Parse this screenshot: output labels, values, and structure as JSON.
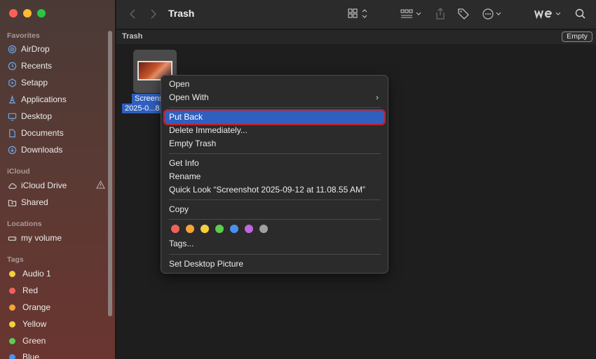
{
  "window": {
    "title": "Trash"
  },
  "sidebar": {
    "favorites_title": "Favorites",
    "favorites": [
      {
        "label": "AirDrop",
        "icon": "airdrop-icon"
      },
      {
        "label": "Recents",
        "icon": "clock-icon"
      },
      {
        "label": "Setapp",
        "icon": "setapp-icon"
      },
      {
        "label": "Applications",
        "icon": "applications-icon"
      },
      {
        "label": "Desktop",
        "icon": "desktop-icon"
      },
      {
        "label": "Documents",
        "icon": "document-icon"
      },
      {
        "label": "Downloads",
        "icon": "download-icon"
      }
    ],
    "icloud_title": "iCloud",
    "icloud": [
      {
        "label": "iCloud Drive",
        "icon": "cloud-icon",
        "status_icon": "warning-icon"
      },
      {
        "label": "Shared",
        "icon": "shared-folder-icon"
      }
    ],
    "locations_title": "Locations",
    "locations": [
      {
        "label": "my volume",
        "icon": "drive-icon"
      }
    ],
    "tags_title": "Tags",
    "tags": [
      {
        "label": "Audio 1",
        "color": "#f4d03f"
      },
      {
        "label": "Red",
        "color": "#f0625a"
      },
      {
        "label": "Orange",
        "color": "#f5a536"
      },
      {
        "label": "Yellow",
        "color": "#f4d03f"
      },
      {
        "label": "Green",
        "color": "#5ccd4e"
      },
      {
        "label": "Blue",
        "color": "#4a90ee"
      }
    ]
  },
  "pathbar": {
    "label": "Trash",
    "empty_button": "Empty"
  },
  "file": {
    "name_line1": "Screens",
    "name_line2": "2025-0...8"
  },
  "context_menu": {
    "items": [
      {
        "label": "Open"
      },
      {
        "label": "Open With",
        "has_submenu": true
      },
      {
        "label": "Put Back",
        "selected": true
      },
      {
        "label": "Delete Immediately..."
      },
      {
        "label": "Empty Trash"
      },
      {
        "label": "Get Info"
      },
      {
        "label": "Rename"
      },
      {
        "label": "Quick Look “Screenshot 2025-09-12 at 11.08.55 AM”"
      },
      {
        "label": "Copy"
      },
      {
        "label": "Tags..."
      },
      {
        "label": "Set Desktop Picture"
      }
    ],
    "tag_colors": [
      "#f0625a",
      "#f5a536",
      "#f4d03f",
      "#5ccd4e",
      "#4a90ee",
      "#c066e0",
      "#a0a0a0"
    ],
    "submenu_arrow": "›"
  },
  "colors": {
    "selection": "#2f5fbf",
    "highlight_border": "#c41f2c"
  }
}
